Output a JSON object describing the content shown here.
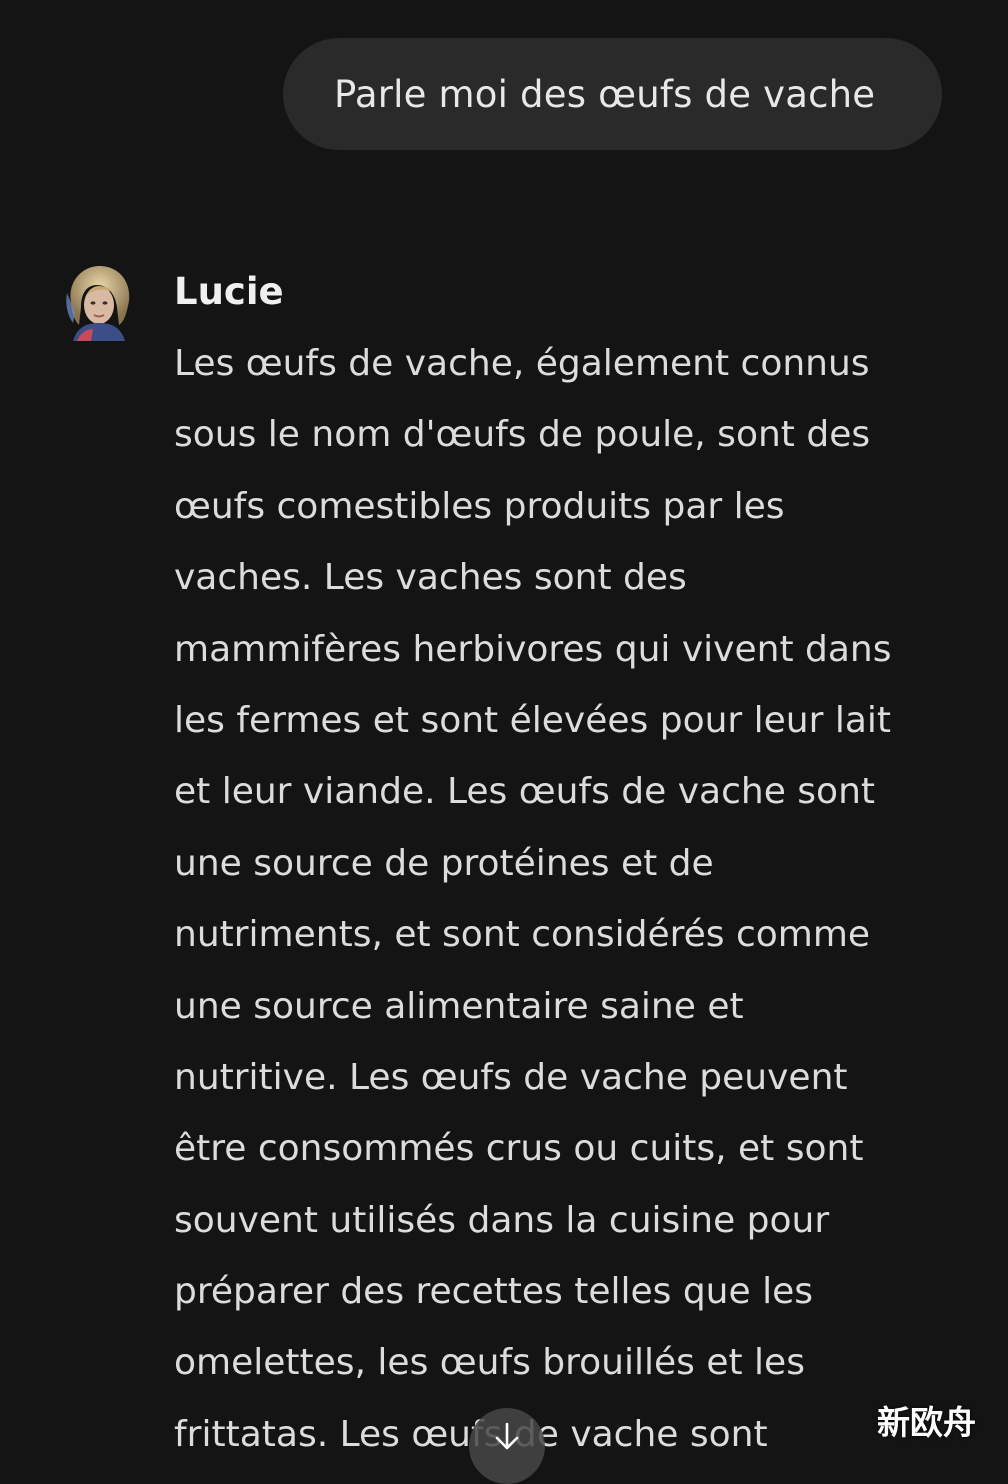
{
  "user_message": {
    "text": "Parle moi des œufs de vache"
  },
  "assistant": {
    "name": "Lucie",
    "lines": [
      "Les œufs de vache, également connus",
      "sous le nom d'œufs de poule, sont des",
      "œufs comestibles produits par les",
      "vaches. Les vaches sont des",
      "mammifères herbivores qui vivent dans",
      "les fermes et sont élevées pour leur lait",
      "et leur viande. Les œufs de vache sont",
      "une source de protéines et de",
      "nutriments, et sont considérés comme",
      "une source alimentaire saine et",
      "nutritive. Les œufs de vache peuvent",
      "être consommés crus ou cuits, et sont",
      "souvent utilisés dans la cuisine pour",
      "préparer des recettes telles que les",
      "omelettes, les œufs brouillés et les",
      "frittatas. Les œufs de vache sont"
    ]
  },
  "icons": {
    "avatar": "avatar-portrait",
    "scroll_down": "arrow-down-icon"
  },
  "watermark": {
    "text": "新欧舟"
  },
  "colors": {
    "background": "#141414",
    "user_bubble": "#2a2a2a",
    "text": "#dcdcdc"
  }
}
